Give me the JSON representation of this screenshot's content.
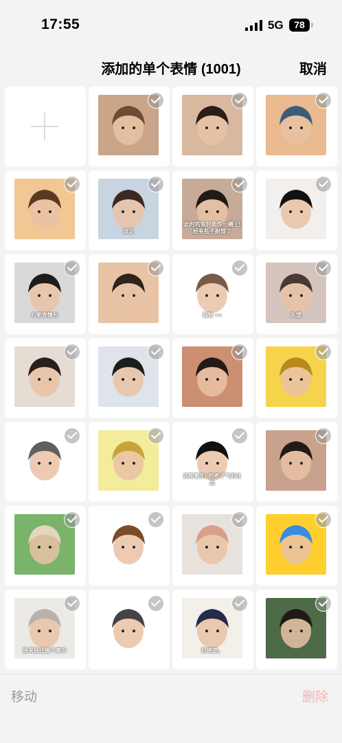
{
  "status_bar": {
    "time": "17:55",
    "network": "5G",
    "battery": "78"
  },
  "nav": {
    "title": "添加的单个表情 (1001)",
    "cancel_label": "取消"
  },
  "grid": {
    "items": [
      {
        "kind": "add",
        "icon": "plus-icon"
      },
      {
        "kind": "sticker",
        "palette": [
          "#c9a58a",
          "#6f4a35"
        ],
        "caption": ""
      },
      {
        "kind": "sticker",
        "palette": [
          "#d9b8a0",
          "#2b1d18"
        ],
        "caption": ""
      },
      {
        "kind": "sticker",
        "palette": [
          "#e9b98f",
          "#3d5c7a"
        ],
        "caption": ""
      },
      {
        "kind": "sticker",
        "palette": [
          "#f1c793",
          "#5a3a20"
        ],
        "caption": ""
      },
      {
        "kind": "sticker",
        "palette": [
          "#c8d4df",
          "#3b2a22"
        ],
        "caption": "淡定"
      },
      {
        "kind": "sticker",
        "palette": [
          "#c7ab98",
          "#1f1a17"
        ],
        "caption": "此时的贫时那传一横 已经有些不耐烦了"
      },
      {
        "kind": "sticker",
        "palette": [
          "#f2efec",
          "#111111"
        ],
        "caption": ""
      },
      {
        "kind": "sticker",
        "palette": [
          "#d9d9d9",
          "#1c1c1c"
        ],
        "caption": "万能表情包"
      },
      {
        "kind": "sticker",
        "palette": [
          "#e8c4a4",
          "#2e241d"
        ],
        "caption": ""
      },
      {
        "kind": "sticker",
        "palette": [
          "#ffffff",
          "#7a5a48"
        ],
        "caption": "弱智 +∞"
      },
      {
        "kind": "sticker",
        "palette": [
          "#d5c4bd",
          "#4a3a33"
        ],
        "caption": "失望"
      },
      {
        "kind": "sticker",
        "palette": [
          "#e5dcd3",
          "#2a1f1a"
        ],
        "caption": ""
      },
      {
        "kind": "sticker",
        "palette": [
          "#dfe3ea",
          "#1c1c1c"
        ],
        "caption": ""
      },
      {
        "kind": "sticker",
        "palette": [
          "#cc8f72",
          "#221a16"
        ],
        "caption": ""
      },
      {
        "kind": "sticker",
        "palette": [
          "#f6d34a",
          "#b88a1d"
        ],
        "caption": ""
      },
      {
        "kind": "sticker",
        "palette": [
          "#ffffff",
          "#5f5f5f"
        ],
        "caption": ""
      },
      {
        "kind": "sticker",
        "palette": [
          "#f3ec9a",
          "#c6a43a"
        ],
        "caption": ""
      },
      {
        "kind": "sticker",
        "palette": [
          "#ffffff",
          "#111111"
        ],
        "caption": "这帮畜生! 把老子气的吐血"
      },
      {
        "kind": "sticker",
        "palette": [
          "#c8a28d",
          "#1f1b19"
        ],
        "caption": ""
      },
      {
        "kind": "sticker",
        "palette": [
          "#7ab36a",
          "#e3d5c0"
        ],
        "caption": ""
      },
      {
        "kind": "sticker",
        "palette": [
          "#ffffff",
          "#7a4a2a"
        ],
        "caption": ""
      },
      {
        "kind": "sticker",
        "palette": [
          "#e7e2de",
          "#d6a08a"
        ],
        "caption": ""
      },
      {
        "kind": "sticker",
        "palette": [
          "#ffcf2f",
          "#3a8be0"
        ],
        "caption": ""
      },
      {
        "kind": "sticker",
        "palette": [
          "#eceae6",
          "#b9b2aa"
        ],
        "caption": "独来独往像个高手"
      },
      {
        "kind": "sticker",
        "palette": [
          "#ffffff",
          "#444444"
        ],
        "caption": ""
      },
      {
        "kind": "sticker",
        "palette": [
          "#f3efe9",
          "#252c4a"
        ],
        "caption": "好绝望。"
      },
      {
        "kind": "sticker",
        "palette": [
          "#4d6b47",
          "#1e1a17"
        ],
        "caption": ""
      }
    ]
  },
  "bottom": {
    "move_label": "移动",
    "delete_label": "删除"
  },
  "colors": {
    "check_bg": "#969696",
    "delete_disabled": "#f4b2b2",
    "move_disabled": "#999999"
  }
}
